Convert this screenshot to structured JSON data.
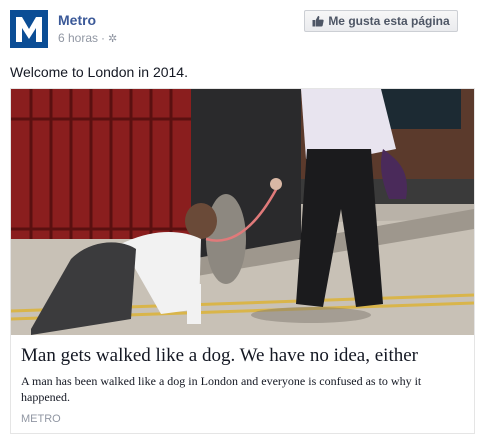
{
  "post": {
    "page_name": "Metro",
    "timestamp": "6 horas",
    "separator": "·",
    "message": "Welcome to London in 2014.",
    "avatar_letter": "M"
  },
  "like_button": {
    "label": "Me gusta esta página",
    "icon": "thumbs-up-icon"
  },
  "attachment": {
    "title": "Man gets walked like a dog. We have no idea, either",
    "description": "A man has been walked like a dog in London and everyone is confused as to why it happened.",
    "source": "METRO"
  },
  "colors": {
    "brand_blue": "#3b5998",
    "metro_blue": "#0b4d95",
    "meta_gray": "#9197a3"
  }
}
